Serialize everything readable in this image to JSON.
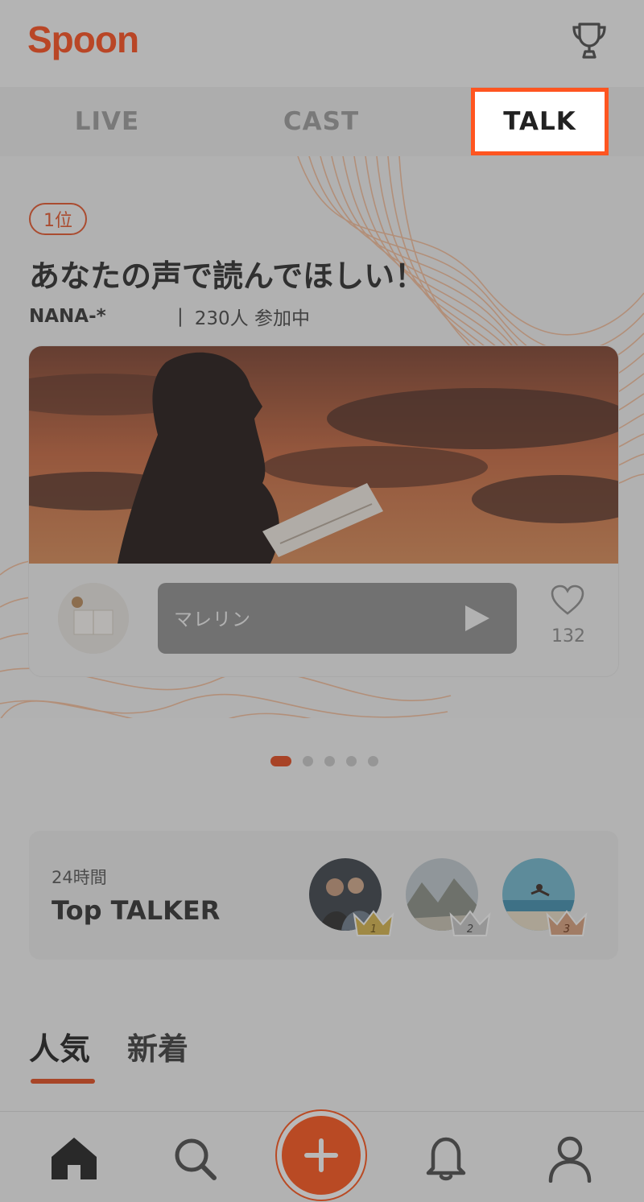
{
  "app": {
    "logo_text": "Spoon",
    "brand_color": "#ff4c1a"
  },
  "header": {
    "trophy_icon": "trophy-icon"
  },
  "tabs": [
    {
      "label": "LIVE",
      "selected": false
    },
    {
      "label": "CAST",
      "selected": false
    },
    {
      "label": "TALK",
      "selected": true
    }
  ],
  "featured": {
    "rank_label": "1位",
    "title": "あなたの声で読んでほしい！",
    "host": "NANA-*",
    "separator": "|",
    "participants": "230人 参加中",
    "reply": {
      "speaker": "マレリン",
      "play_icon": "play-icon"
    },
    "likes": "132",
    "like_icon": "heart-icon"
  },
  "carousel": {
    "total": 5,
    "active": 1
  },
  "top_talker": {
    "caption": "24時間",
    "title": "Top TALKER",
    "ranks": [
      {
        "rank": "1",
        "crown_color": "#d7b44a"
      },
      {
        "rank": "2",
        "crown_color": "#c8c8c8"
      },
      {
        "rank": "3",
        "crown_color": "#d9a07c"
      }
    ]
  },
  "sort_tabs": [
    {
      "label": "人気",
      "selected": true
    },
    {
      "label": "新着",
      "selected": false
    }
  ],
  "bottom_nav": {
    "items": [
      {
        "icon": "home-icon",
        "selected": true
      },
      {
        "icon": "search-icon",
        "selected": false
      },
      {
        "icon": "plus-icon",
        "selected": false
      },
      {
        "icon": "bell-icon",
        "selected": false
      },
      {
        "icon": "profile-icon",
        "selected": false
      }
    ]
  }
}
